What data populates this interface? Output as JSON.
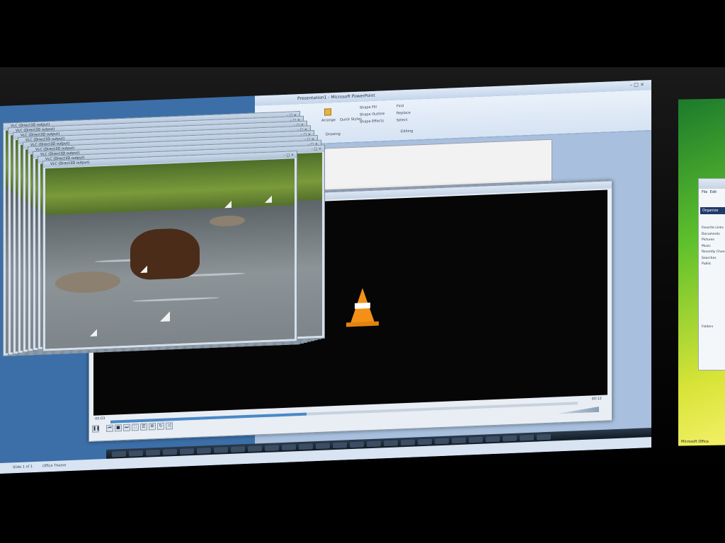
{
  "powerpoint": {
    "title": "Presentation1 - Microsoft PowerPoint",
    "window_controls": "–  □  ×",
    "ribbon": {
      "groups": [
        "Drawing",
        "Editing"
      ],
      "items": [
        "Arrange",
        "Quick Styles",
        "Shape Fill",
        "Shape Outline",
        "Shape Effects",
        "Find",
        "Replace",
        "Select"
      ]
    },
    "status": {
      "slide": "Slide 1 of 1",
      "theme": "Office Theme"
    }
  },
  "vlc": {
    "window_title": "VLC (Direct3D output)",
    "window_controls": "–  □  ×",
    "time_elapsed": "00:03",
    "time_total": "00:12",
    "playback_progress": 0.42,
    "controls": [
      "play-pause",
      "previous",
      "stop",
      "next",
      "fullscreen",
      "playlist",
      "extended",
      "loop",
      "random"
    ],
    "cascade_count": 9
  },
  "right_monitor": {
    "menu": [
      "File",
      "Edit"
    ],
    "organize": "Organize",
    "list": [
      "Favorite Links",
      "Documents",
      "Pictures",
      "Music",
      "Recently Changed",
      "Searches",
      "Public"
    ],
    "folders_label": "Folders",
    "footer": "Microsoft Office"
  },
  "colors": {
    "desktop": "#3c6fa8",
    "vlc_cone": "#f39018",
    "seek_fill": "#4a88c8"
  }
}
